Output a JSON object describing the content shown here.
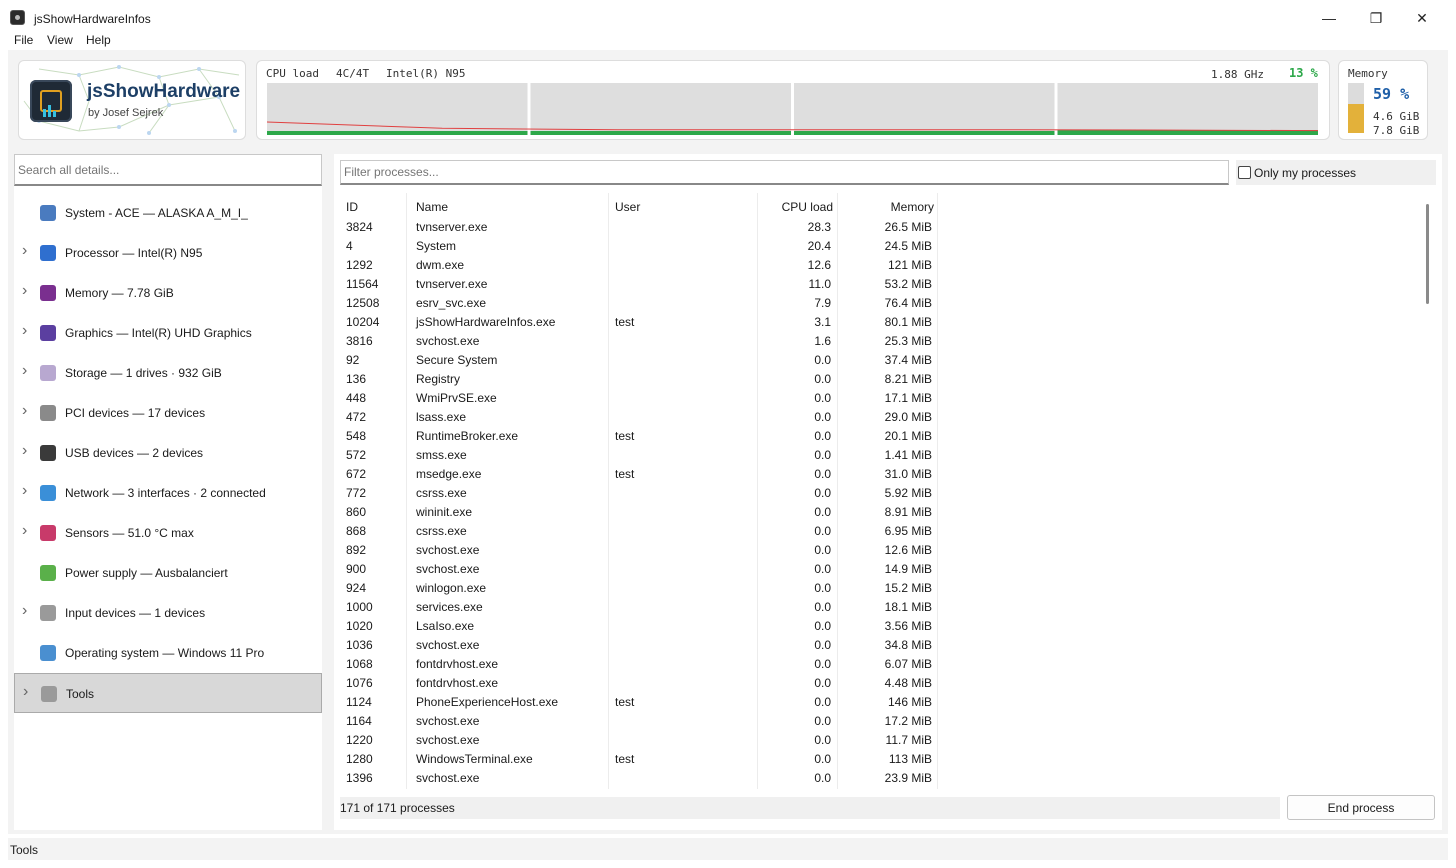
{
  "window": {
    "title": "jsShowHardwareInfos",
    "minimize": "—",
    "maximize": "❐",
    "close": "✕"
  },
  "menu": [
    "File",
    "View",
    "Help"
  ],
  "logo": {
    "name": "jsShowHardware",
    "author": "by Josef Sejrek"
  },
  "cpu": {
    "label": "CPU load",
    "cores": "4C/4T",
    "model": "Intel(R) N95",
    "freq": "1.88 GHz",
    "percent": "13 %",
    "core_loads": [
      0.08,
      0.12,
      0.08,
      0.17
    ],
    "history": [
      0.42,
      0.2,
      0.15,
      0.15,
      0.15,
      0.14,
      0.12
    ],
    "colors": {
      "bar": "#2da84a",
      "line": "#e04040",
      "bg": "#dedede"
    }
  },
  "memory": {
    "label": "Memory",
    "percent": "59 %",
    "used": "4.6 GiB",
    "total": "7.8 GiB",
    "fraction": 0.59
  },
  "left": {
    "search_placeholder": "Search all details...",
    "items": [
      {
        "label": "System - ACE  —  ALASKA A_M_I_",
        "icon": "building-icon",
        "color": "#4a7bbf",
        "chevron": false
      },
      {
        "label": "Processor  —  Intel(R) N95",
        "icon": "cpu-icon",
        "color": "#2f6fcf",
        "chevron": true
      },
      {
        "label": "Memory  —  7.78 GiB",
        "icon": "floppy-icon",
        "color": "#7a2f8f",
        "chevron": true
      },
      {
        "label": "Graphics  —  Intel(R) UHD Graphics",
        "icon": "gamepad-icon",
        "color": "#5b3fa0",
        "chevron": true
      },
      {
        "label": "Storage  —  1 drives · 932 GiB",
        "icon": "disc-icon",
        "color": "#b8a8d0",
        "chevron": true
      },
      {
        "label": "PCI devices  —  17 devices",
        "icon": "pci-card-icon",
        "color": "#8a8a8a",
        "chevron": true
      },
      {
        "label": "USB devices  —  2 devices",
        "icon": "usb-plug-icon",
        "color": "#3a3a3a",
        "chevron": true
      },
      {
        "label": "Network  —  3 interfaces · 2 connected",
        "icon": "globe-icon",
        "color": "#3a8fd8",
        "chevron": true
      },
      {
        "label": "Sensors  —  51.0 °C max",
        "icon": "thermometer-icon",
        "color": "#c83a6a",
        "chevron": true
      },
      {
        "label": "Power supply  —  Ausbalanciert",
        "icon": "battery-icon",
        "color": "#5ab04a",
        "chevron": false
      },
      {
        "label": "Input devices  —  1 devices",
        "icon": "keyboard-icon",
        "color": "#9a9a9a",
        "chevron": true
      },
      {
        "label": "Operating system  —  Windows 11 Pro",
        "icon": "monitor-icon",
        "color": "#4a8fd0",
        "chevron": false
      },
      {
        "label": "Tools",
        "icon": "wrench-icon",
        "color": "#9a9a9a",
        "chevron": true,
        "selected": true
      }
    ]
  },
  "processes": {
    "filter_placeholder": "Filter processes...",
    "only_mine": "Only my processes",
    "columns": [
      "ID",
      "Name",
      "User",
      "CPU load",
      "Memory"
    ],
    "rows": [
      [
        "3824",
        "tvnserver.exe",
        "",
        "28.3",
        "26.5 MiB"
      ],
      [
        "4",
        "System",
        "",
        "20.4",
        "24.5 MiB"
      ],
      [
        "1292",
        "dwm.exe",
        "",
        "12.6",
        "121 MiB"
      ],
      [
        "11564",
        "tvnserver.exe",
        "",
        "11.0",
        "53.2 MiB"
      ],
      [
        "12508",
        "esrv_svc.exe",
        "",
        "7.9",
        "76.4 MiB"
      ],
      [
        "10204",
        "jsShowHardwareInfos.exe",
        "test",
        "3.1",
        "80.1 MiB"
      ],
      [
        "3816",
        "svchost.exe",
        "",
        "1.6",
        "25.3 MiB"
      ],
      [
        "92",
        "Secure System",
        "",
        "0.0",
        "37.4 MiB"
      ],
      [
        "136",
        "Registry",
        "",
        "0.0",
        "8.21 MiB"
      ],
      [
        "448",
        "WmiPrvSE.exe",
        "",
        "0.0",
        "17.1 MiB"
      ],
      [
        "472",
        "lsass.exe",
        "",
        "0.0",
        "29.0 MiB"
      ],
      [
        "548",
        "RuntimeBroker.exe",
        "test",
        "0.0",
        "20.1 MiB"
      ],
      [
        "572",
        "smss.exe",
        "",
        "0.0",
        "1.41 MiB"
      ],
      [
        "672",
        "msedge.exe",
        "test",
        "0.0",
        "31.0 MiB"
      ],
      [
        "772",
        "csrss.exe",
        "",
        "0.0",
        "5.92 MiB"
      ],
      [
        "860",
        "wininit.exe",
        "",
        "0.0",
        "8.91 MiB"
      ],
      [
        "868",
        "csrss.exe",
        "",
        "0.0",
        "6.95 MiB"
      ],
      [
        "892",
        "svchost.exe",
        "",
        "0.0",
        "12.6 MiB"
      ],
      [
        "900",
        "svchost.exe",
        "",
        "0.0",
        "14.9 MiB"
      ],
      [
        "924",
        "winlogon.exe",
        "",
        "0.0",
        "15.2 MiB"
      ],
      [
        "1000",
        "services.exe",
        "",
        "0.0",
        "18.1 MiB"
      ],
      [
        "1020",
        "LsaIso.exe",
        "",
        "0.0",
        "3.56 MiB"
      ],
      [
        "1036",
        "svchost.exe",
        "",
        "0.0",
        "34.8 MiB"
      ],
      [
        "1068",
        "fontdrvhost.exe",
        "",
        "0.0",
        "6.07 MiB"
      ],
      [
        "1076",
        "fontdrvhost.exe",
        "",
        "0.0",
        "4.48 MiB"
      ],
      [
        "1124",
        "PhoneExperienceHost.exe",
        "test",
        "0.0",
        "146 MiB"
      ],
      [
        "1164",
        "svchost.exe",
        "",
        "0.0",
        "17.2 MiB"
      ],
      [
        "1220",
        "svchost.exe",
        "",
        "0.0",
        "11.7 MiB"
      ],
      [
        "1280",
        "WindowsTerminal.exe",
        "test",
        "0.0",
        "113 MiB"
      ],
      [
        "1396",
        "svchost.exe",
        "",
        "0.0",
        "23.9 MiB"
      ]
    ],
    "count": "171 of 171 processes",
    "end_button": "End process"
  },
  "status": "Tools"
}
